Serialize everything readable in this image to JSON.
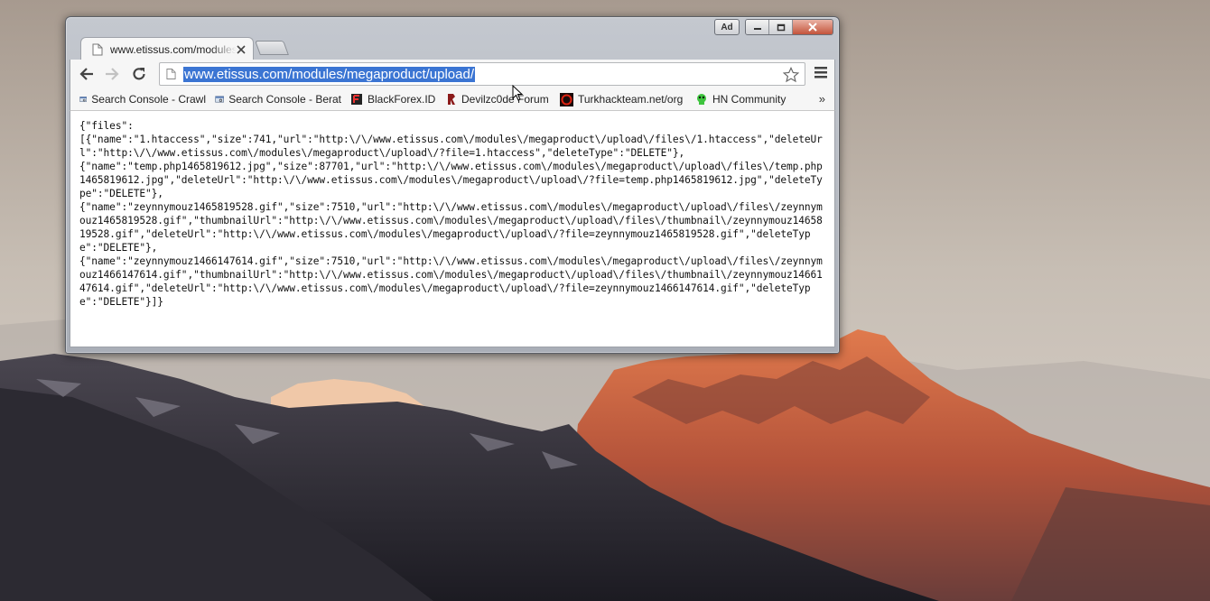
{
  "desktop": {
    "wallpaper": "mountain-sunset"
  },
  "window": {
    "ad_badge": "Ad",
    "controls": [
      "minimize",
      "maximize",
      "close"
    ]
  },
  "tabs": [
    {
      "title": "www.etissus.com/modules/megaproduct/upload/",
      "icon": "page-icon",
      "active": true
    }
  ],
  "toolbar": {
    "url": "www.etissus.com/modules/megaproduct/upload/",
    "url_selected": true
  },
  "bookmarks": [
    {
      "label": "Search Console - Crawl",
      "icon": "search-console-icon"
    },
    {
      "label": "Search Console - Berat",
      "icon": "search-console-icon"
    },
    {
      "label": "BlackForex.ID",
      "icon": "blackforex-icon"
    },
    {
      "label": "Devilzc0de Forum",
      "icon": "devilzc0de-icon"
    },
    {
      "label": "Turkhackteam.net/org",
      "icon": "turkhackteam-icon"
    },
    {
      "label": "HN Community",
      "icon": "hn-community-icon"
    }
  ],
  "bookmarks_more": "»",
  "content": {
    "json": "{\"files\":\n[{\"name\":\"1.htaccess\",\"size\":741,\"url\":\"http:\\/\\/www.etissus.com\\/modules\\/megaproduct\\/upload\\/files\\/1.htaccess\",\"deleteUrl\":\"http:\\/\\/www.etissus.com\\/modules\\/megaproduct\\/upload\\/?file=1.htaccess\",\"deleteType\":\"DELETE\"},\n{\"name\":\"temp.php1465819612.jpg\",\"size\":87701,\"url\":\"http:\\/\\/www.etissus.com\\/modules\\/megaproduct\\/upload\\/files\\/temp.php1465819612.jpg\",\"deleteUrl\":\"http:\\/\\/www.etissus.com\\/modules\\/megaproduct\\/upload\\/?file=temp.php1465819612.jpg\",\"deleteType\":\"DELETE\"},\n{\"name\":\"zeynnymouz1465819528.gif\",\"size\":7510,\"url\":\"http:\\/\\/www.etissus.com\\/modules\\/megaproduct\\/upload\\/files\\/zeynnymouz1465819528.gif\",\"thumbnailUrl\":\"http:\\/\\/www.etissus.com\\/modules\\/megaproduct\\/upload\\/files\\/thumbnail\\/zeynnymouz1465819528.gif\",\"deleteUrl\":\"http:\\/\\/www.etissus.com\\/modules\\/megaproduct\\/upload\\/?file=zeynnymouz1465819528.gif\",\"deleteType\":\"DELETE\"},\n{\"name\":\"zeynnymouz1466147614.gif\",\"size\":7510,\"url\":\"http:\\/\\/www.etissus.com\\/modules\\/megaproduct\\/upload\\/files\\/zeynnymouz1466147614.gif\",\"thumbnailUrl\":\"http:\\/\\/www.etissus.com\\/modules\\/megaproduct\\/upload\\/files\\/thumbnail\\/zeynnymouz1466147614.gif\",\"deleteUrl\":\"http:\\/\\/www.etissus.com\\/modules\\/megaproduct\\/upload\\/?file=zeynnymouz1466147614.gif\",\"deleteType\":\"DELETE\"}]}"
  }
}
